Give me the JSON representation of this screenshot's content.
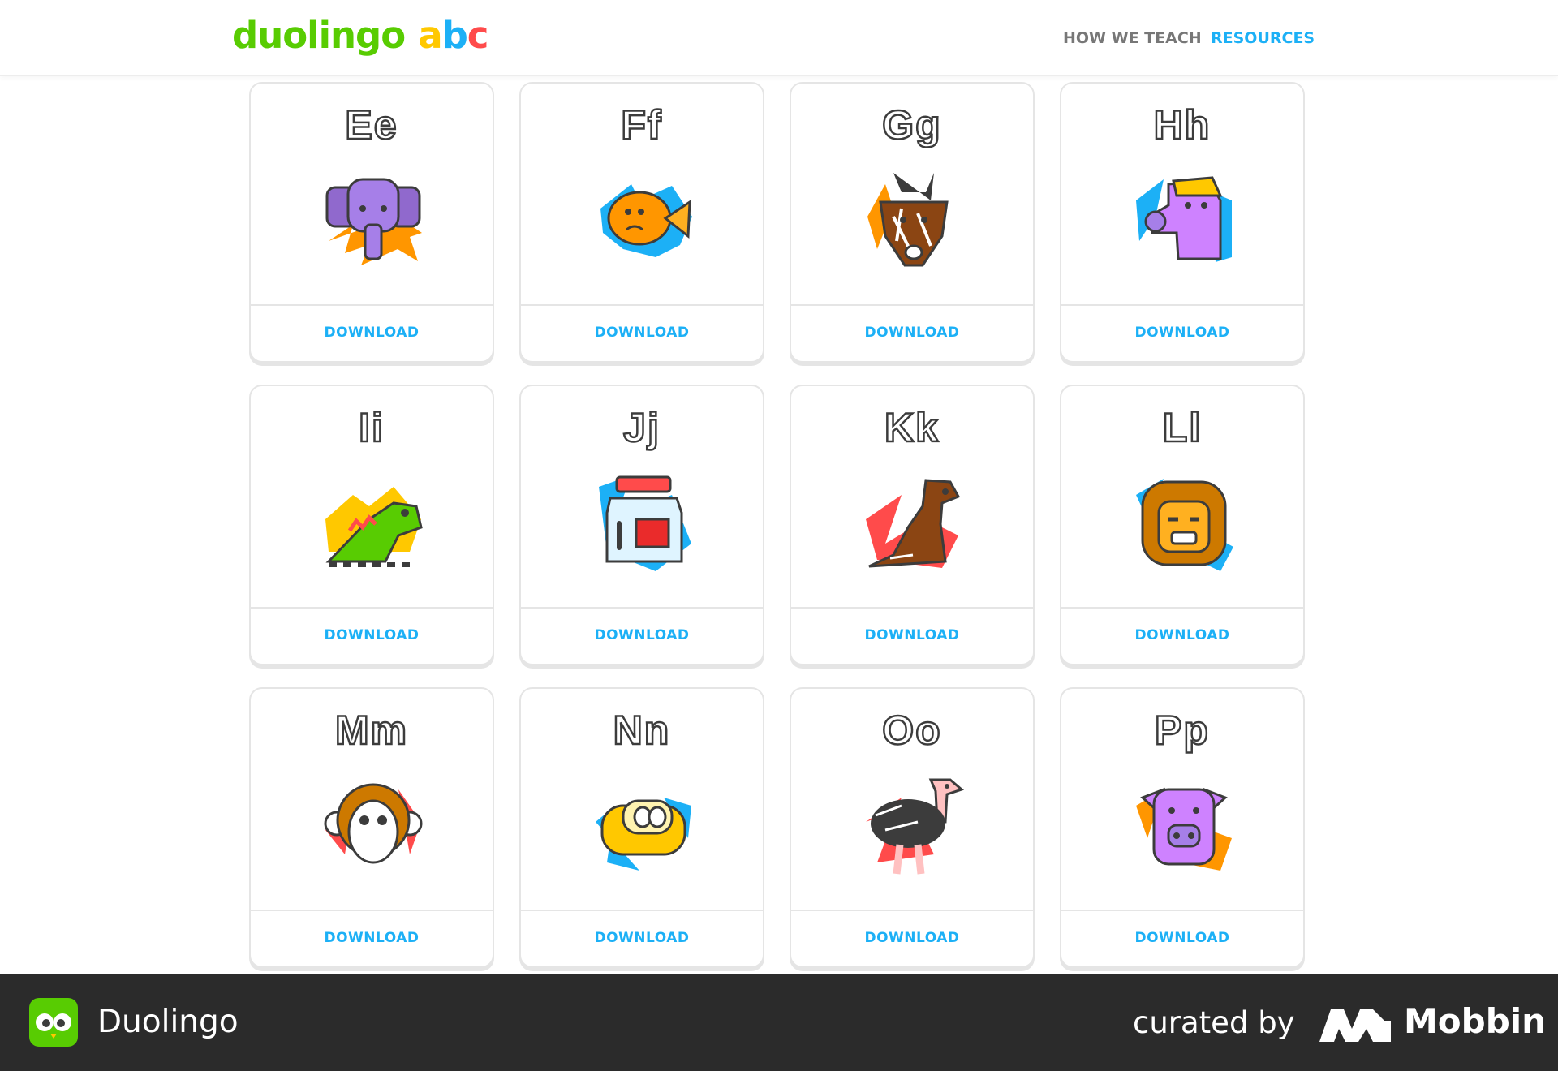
{
  "header": {
    "logo_word": "duolingo",
    "logo_abc": [
      "a",
      "b",
      "c"
    ],
    "nav": [
      {
        "label": "HOW WE TEACH"
      },
      {
        "label": "RESOURCES"
      }
    ]
  },
  "cards": [
    {
      "letter": "Ee",
      "animal": "elephant",
      "download_label": "DOWNLOAD"
    },
    {
      "letter": "Ff",
      "animal": "fish",
      "download_label": "DOWNLOAD"
    },
    {
      "letter": "Gg",
      "animal": "goat",
      "download_label": "DOWNLOAD"
    },
    {
      "letter": "Hh",
      "animal": "horse",
      "download_label": "DOWNLOAD"
    },
    {
      "letter": "Ii",
      "animal": "iguana",
      "download_label": "DOWNLOAD"
    },
    {
      "letter": "Jj",
      "animal": "jar",
      "download_label": "DOWNLOAD"
    },
    {
      "letter": "Kk",
      "animal": "kangaroo",
      "download_label": "DOWNLOAD"
    },
    {
      "letter": "Ll",
      "animal": "lion",
      "download_label": "DOWNLOAD"
    },
    {
      "letter": "Mm",
      "animal": "monkey",
      "download_label": "DOWNLOAD"
    },
    {
      "letter": "Nn",
      "animal": "nest",
      "download_label": "DOWNLOAD"
    },
    {
      "letter": "Oo",
      "animal": "ostrich",
      "download_label": "DOWNLOAD"
    },
    {
      "letter": "Pp",
      "animal": "pig",
      "download_label": "DOWNLOAD"
    }
  ],
  "footer": {
    "brand_name": "Duolingo",
    "curated_label": "curated by",
    "curator_name": "Mobbin"
  },
  "colors": {
    "accent_blue": "#1cb0f6",
    "brand_green": "#58cc02",
    "footer_bg": "#2b2b2b"
  }
}
